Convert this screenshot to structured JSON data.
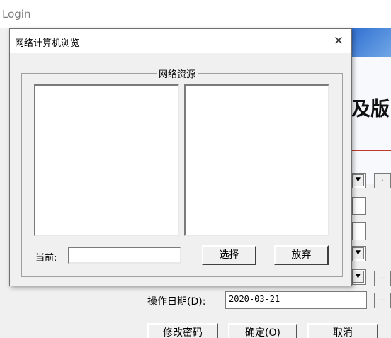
{
  "login_window": {
    "title": "Login",
    "banner_text": "及版",
    "date_label": "操作日期(D):",
    "date_value": "2020-03-21",
    "buttons": {
      "change_password": "修改密码",
      "ok": "确定(O)",
      "cancel": "取消"
    }
  },
  "dialog": {
    "title": "网络计算机浏览",
    "close_icon": "close-icon",
    "group_title": "网络资源",
    "current_label": "当前:",
    "current_value": "",
    "select_button": "选择",
    "abandon_button": "放弃"
  }
}
